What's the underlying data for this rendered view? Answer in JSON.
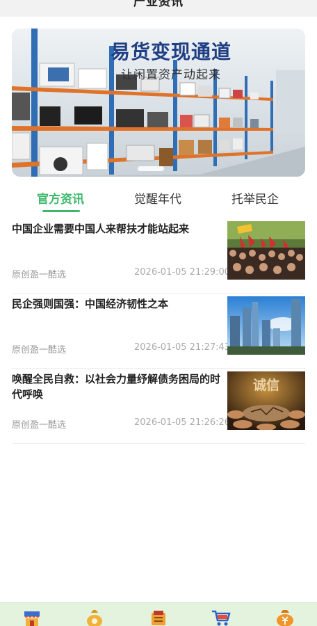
{
  "header": {
    "title": "产业资讯"
  },
  "banner": {
    "headline": "易货变现通道",
    "subline": "让闲置资产动起来"
  },
  "tabs": [
    {
      "label": "官方资讯",
      "active": true
    },
    {
      "label": "觉醒年代",
      "active": false
    },
    {
      "label": "托举民企",
      "active": false
    }
  ],
  "articles": [
    {
      "title": "中国企业需要中国人来帮扶才能站起来",
      "source": "原创盈一酷选",
      "time": "2026-01-05 21:29:00",
      "image": "crowd-with-red-flags"
    },
    {
      "title": "民企强则国强：中国经济韧性之本",
      "source": "原创盈一酷选",
      "time": "2026-01-05 21:27:43",
      "image": "city-skyline"
    },
    {
      "title": "唤醒全民自救：以社会力量纾解债务困局的时代呼唤",
      "source": "原创盈一酷选",
      "time": "2026-01-05 21:26:26",
      "image": "hands-cracked-integrity",
      "image_text": "诚信"
    }
  ],
  "tabbar": {
    "items": [
      {
        "icon": "store-icon"
      },
      {
        "icon": "coin-bag-icon"
      },
      {
        "icon": "exchange-icon"
      },
      {
        "icon": "cart-icon"
      },
      {
        "icon": "yuan-icon"
      }
    ]
  },
  "colors": {
    "accent": "#3db86b",
    "tabbar_bg": "#e3f3de",
    "headline": "#1f3e84"
  }
}
